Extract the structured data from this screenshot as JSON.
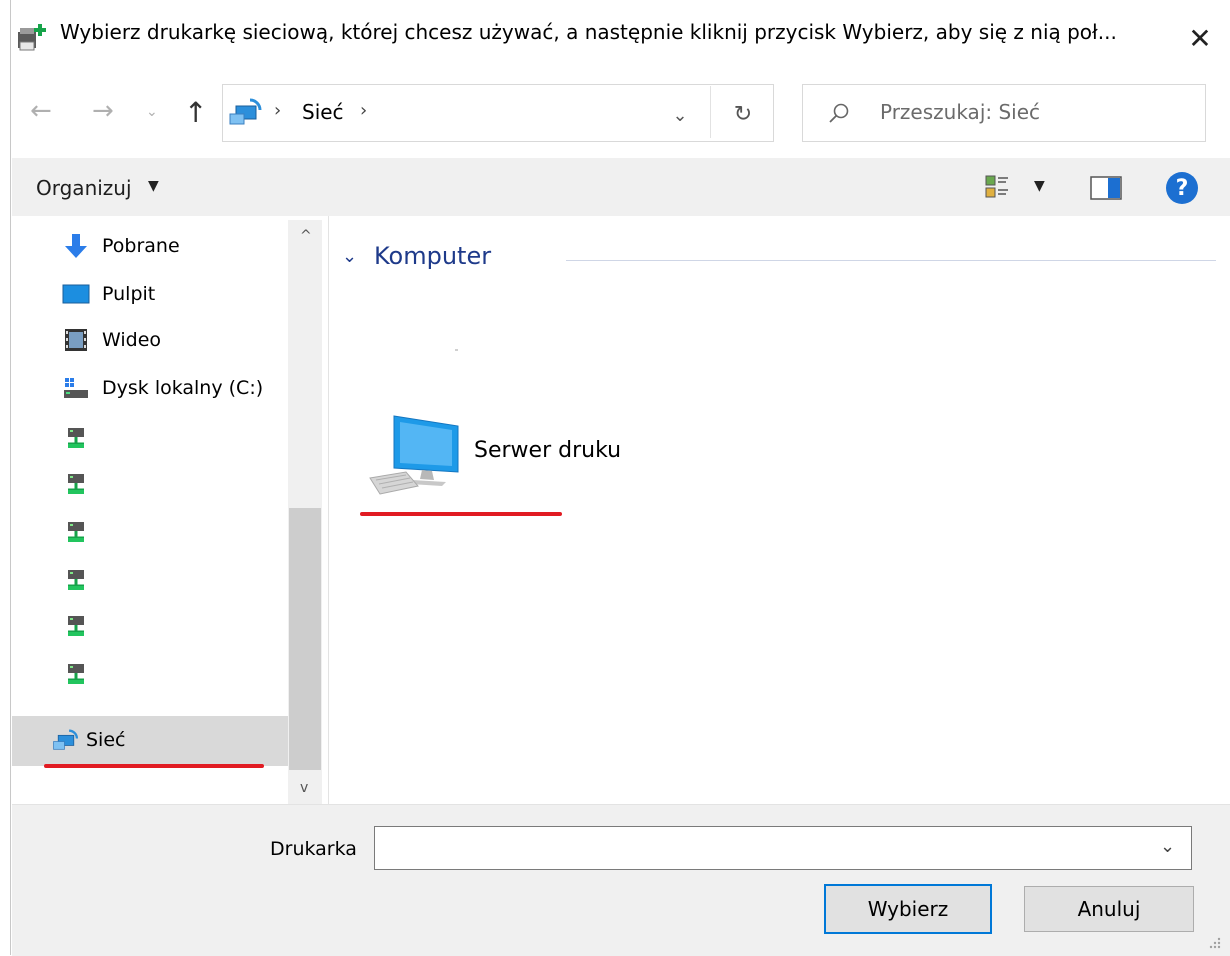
{
  "window": {
    "title": "Wybierz drukarkę sieciową, której chcesz używać, a następnie kliknij przycisk Wybierz, aby się z nią poł...",
    "close_glyph": "✕"
  },
  "nav": {
    "back_glyph": "←",
    "forward_glyph": "→",
    "recent_glyph": "⌄",
    "up_glyph": "↑"
  },
  "address": {
    "sep1": "›",
    "location": "Sieć",
    "sep2": "›",
    "dropdown_glyph": "⌄",
    "refresh_glyph": "↻"
  },
  "search": {
    "placeholder": "Przeszukaj: Sieć"
  },
  "toolbar": {
    "organize_label": "Organizuj",
    "dropdown_glyph": "▼",
    "help_glyph": "?"
  },
  "sidebar": {
    "items": [
      {
        "label": "Pobrane",
        "icon": "download-arrow-icon"
      },
      {
        "label": "Pulpit",
        "icon": "desktop-icon"
      },
      {
        "label": "Wideo",
        "icon": "video-icon"
      },
      {
        "label": "Dysk lokalny (C:)",
        "icon": "local-disk-icon"
      },
      {
        "label": "",
        "icon": "network-drive-icon"
      },
      {
        "label": "",
        "icon": "network-drive-icon"
      },
      {
        "label": "",
        "icon": "network-drive-icon"
      },
      {
        "label": "",
        "icon": "network-drive-icon"
      },
      {
        "label": "",
        "icon": "network-drive-icon"
      },
      {
        "label": "",
        "icon": "network-drive-icon"
      },
      {
        "label": "Sieć",
        "icon": "network-icon",
        "selected": true
      }
    ],
    "scroll_up_glyph": "^",
    "scroll_down_glyph": "v"
  },
  "content": {
    "group_chevron": "⌄",
    "group_label": "Komputer",
    "items": [
      {
        "label": "Serwer druku",
        "icon": "computer-icon"
      }
    ]
  },
  "footer": {
    "printer_label": "Drukarka",
    "printer_value": "",
    "dropdown_glyph": "⌄",
    "choose_label": "Wybierz",
    "cancel_label": "Anuluj"
  },
  "colors": {
    "accent": "#0078d7",
    "link_blue": "#1e3a8a",
    "highlight_red": "#e11b22",
    "selection_gray": "#d9d9d9"
  }
}
